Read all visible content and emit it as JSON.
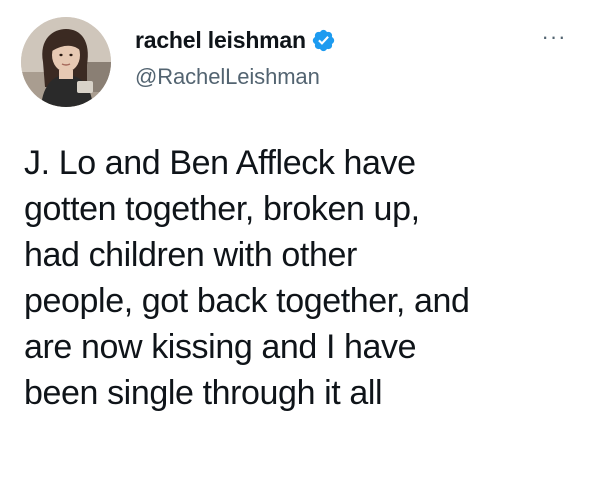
{
  "author": {
    "display_name": "rachel leishman",
    "handle": "@RachelLeishman",
    "verified": true,
    "avatar_icon": "profile-photo"
  },
  "menu": {
    "icon": "more-options-icon",
    "glyph": "···"
  },
  "tweet": {
    "lines": [
      "J. Lo and Ben Affleck have",
      "gotten together, broken up,",
      "had children with other",
      "people, got back together, and",
      "are now kissing and I have",
      "been single through it all"
    ]
  },
  "colors": {
    "text": "#0f1419",
    "secondary_text": "#536471",
    "verified_badge": "#1d9bf0",
    "background": "#ffffff"
  }
}
